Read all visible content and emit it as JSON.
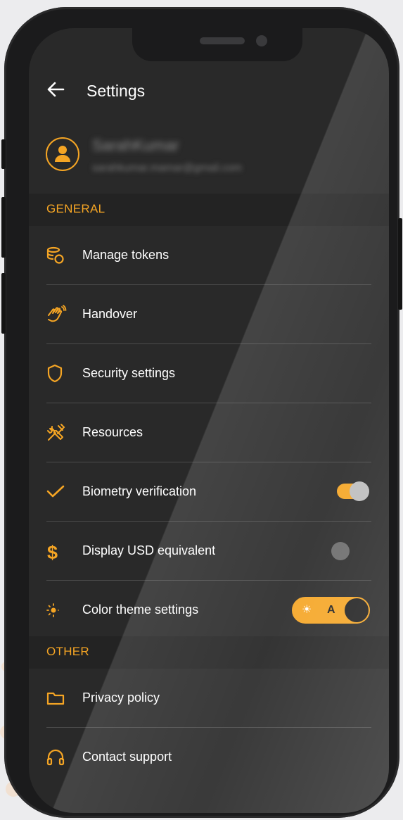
{
  "header": {
    "title": "Settings",
    "back_icon": "arrow-left-icon"
  },
  "profile": {
    "name": "SarahKumar",
    "email": "sarahkumar.mamar@gmail.com"
  },
  "sections": {
    "general": "GENERAL",
    "other": "OTHER"
  },
  "items": {
    "manage_tokens": "Manage tokens",
    "handover": "Handover",
    "security": "Security settings",
    "resources": "Resources",
    "biometry": "Biometry verification",
    "usd": "Display USD equivalent",
    "theme": "Color theme settings",
    "privacy": "Privacy policy",
    "support": "Contact support"
  },
  "toggles": {
    "biometry_on": true,
    "usd_on": false
  },
  "theme_switch": {
    "light_symbol": "☀",
    "auto_label": "A",
    "mode": "dark"
  },
  "colors": {
    "accent": "#f5a524",
    "screen_bg": "#292929",
    "text": "#ffffff"
  }
}
